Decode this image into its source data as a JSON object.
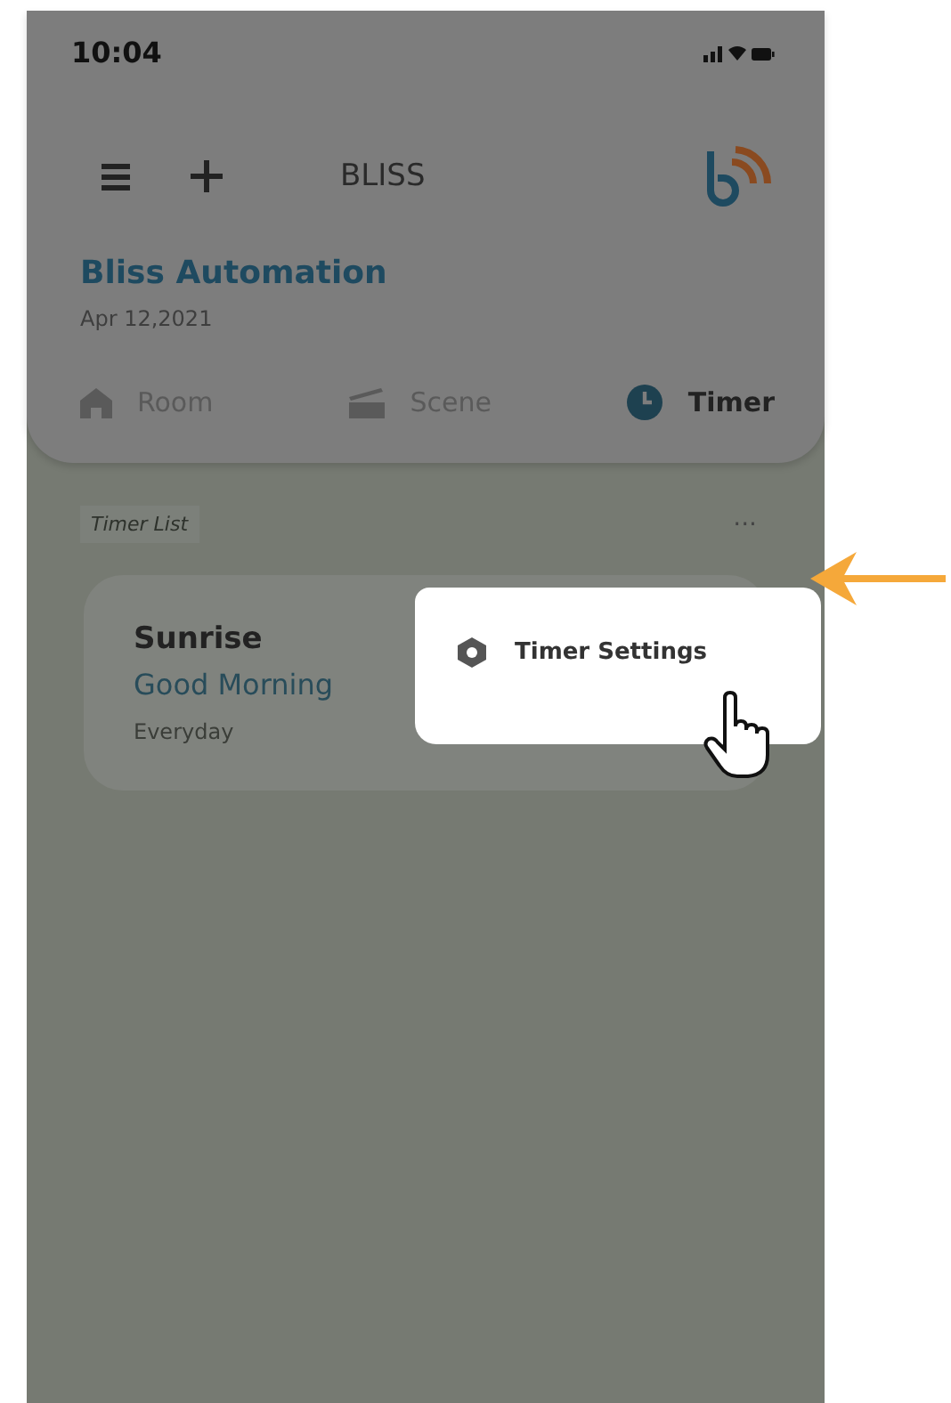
{
  "status_bar": {
    "time": "10:04"
  },
  "header": {
    "title": "BLISS"
  },
  "home": {
    "name": "Bliss Automation",
    "date": "Apr 12,2021"
  },
  "tabs": [
    {
      "label": "Room",
      "selected": false
    },
    {
      "label": "Scene",
      "selected": false
    },
    {
      "label": "Timer",
      "selected": true
    }
  ],
  "timer_list": {
    "label": "Timer List",
    "menu": "···"
  },
  "timers": [
    {
      "name": "Sunrise",
      "scene": "Good Morning",
      "repeat": "Everyday"
    }
  ],
  "popup_menu": {
    "items": [
      {
        "label": "Timer Settings"
      }
    ]
  }
}
